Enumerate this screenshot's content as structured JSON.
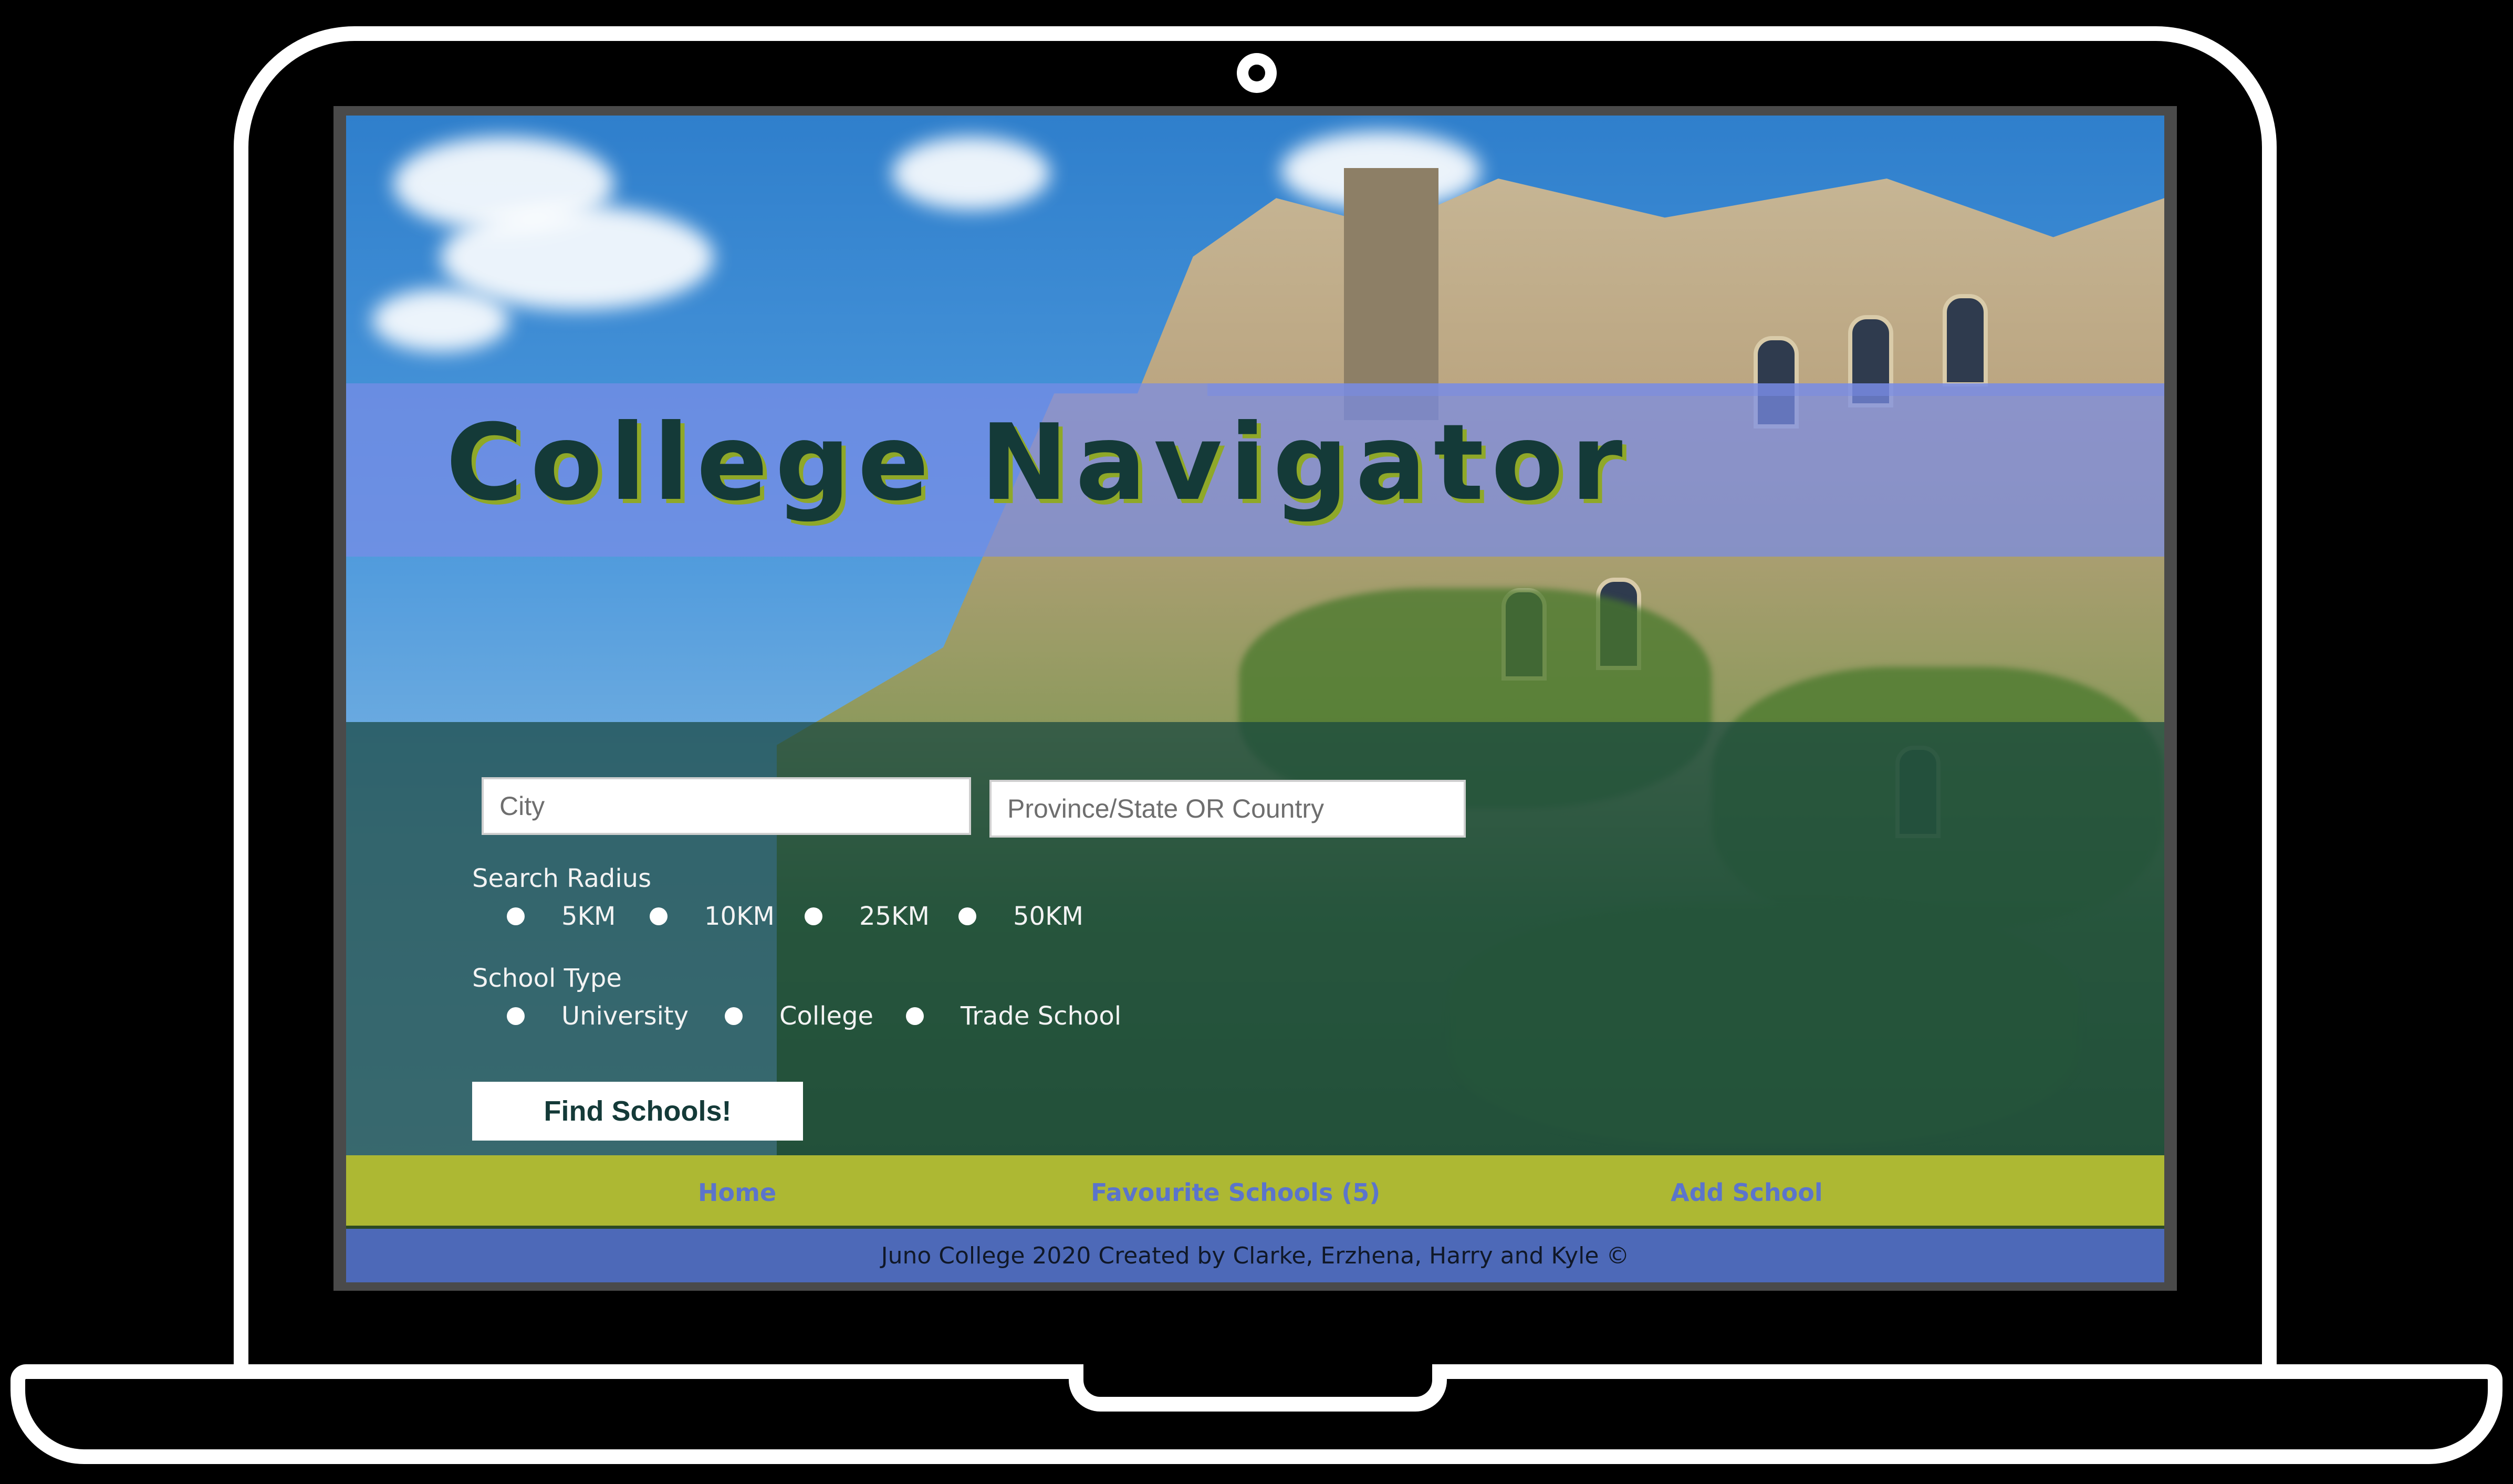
{
  "app": {
    "title": "College Navigator"
  },
  "search": {
    "city_placeholder": "City",
    "region_placeholder": "Province/State OR Country",
    "radius_label": "Search Radius",
    "radius_options": [
      "5KM",
      "10KM",
      "25KM",
      "50KM"
    ],
    "type_label": "School Type",
    "type_options": [
      "University",
      "College",
      "Trade School"
    ],
    "submit_label": "Find Schools!"
  },
  "nav": {
    "items": [
      {
        "label": "Home"
      },
      {
        "label": "Favourite Schools (5)"
      },
      {
        "label": "Add School"
      }
    ]
  },
  "footer": {
    "text": "Juno College 2020 Created by Clarke, Erzhena, Harry and Kyle ©"
  },
  "colors": {
    "title_text": "#143a38",
    "title_shadow": "#8fa828",
    "title_band": "#788ce6",
    "form_band": "#184640",
    "nav_bar": "#adb833",
    "nav_link": "#5b74cc",
    "footer_bg": "#4d69b8"
  }
}
